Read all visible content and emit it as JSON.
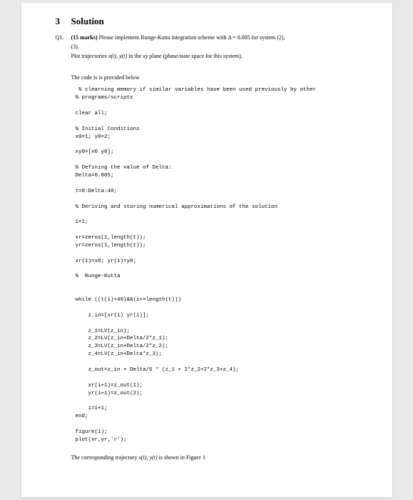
{
  "section": {
    "number": "3",
    "title": "Solution"
  },
  "question": {
    "label": "Q1.",
    "marks": "(15 marks)",
    "line1_a": " Please implement Runge-Kutta integration scheme with ",
    "delta_eq": "Δ = 0.005",
    "line1_b": " for system (2),",
    "line2": "(3).",
    "line3_a": "Plot trajectories ",
    "xy_t": "x(t), y(t)",
    "line3_b": " in the ",
    "xy_plane": "xy",
    "line3_c": " plane (phase/state space for this system)."
  },
  "intro": "The code is is provided below",
  "code": " % clearning memory if similar variables have been used previously by other\n% programs/scripts\n\nclear all;\n\n% Initial Conditions\nx0=1; y0=2;\n\nxy0=[x0 y0];\n\n% Defining the value of Delta:\nDelta=0.005;\n\nt=0:Delta:40;\n\n% Deriving and storing numerical approximations of the solution\n\ni=1;\n\nxr=zeros(1,length(t));\nyr=zeros(1,length(t));\n\nxr(1)=x0; yr(1)=y0;\n\n%  Runge-Kutta\n\n\nwhile ((t(i)<40)&&(i<=length(t)))\n\n    z_in=[xr(i) yr(i)];\n\n    z_1=LV(z_in);\n    z_2=LV(z_in+Delta/2*z_1);\n    z_3=LV(z_in+Delta/2*z_2);\n    z_4=LV(z_in+Delta*z_3);\n\n    z_out=z_in + Delta/6 * (z_1 + 2*z_2+2*z_3+z_4);\n\n    xr(i+1)=z_out(1);\n    yr(i+1)=z_out(2);\n\n    i=i+1;\nend;\n\nfigure(1);\nplot(xr,yr,'r');",
  "closing_a": "The corresponding trajectory ",
  "closing_xy": "x(t), y(t)",
  "closing_b": " is shown in Figure 1"
}
